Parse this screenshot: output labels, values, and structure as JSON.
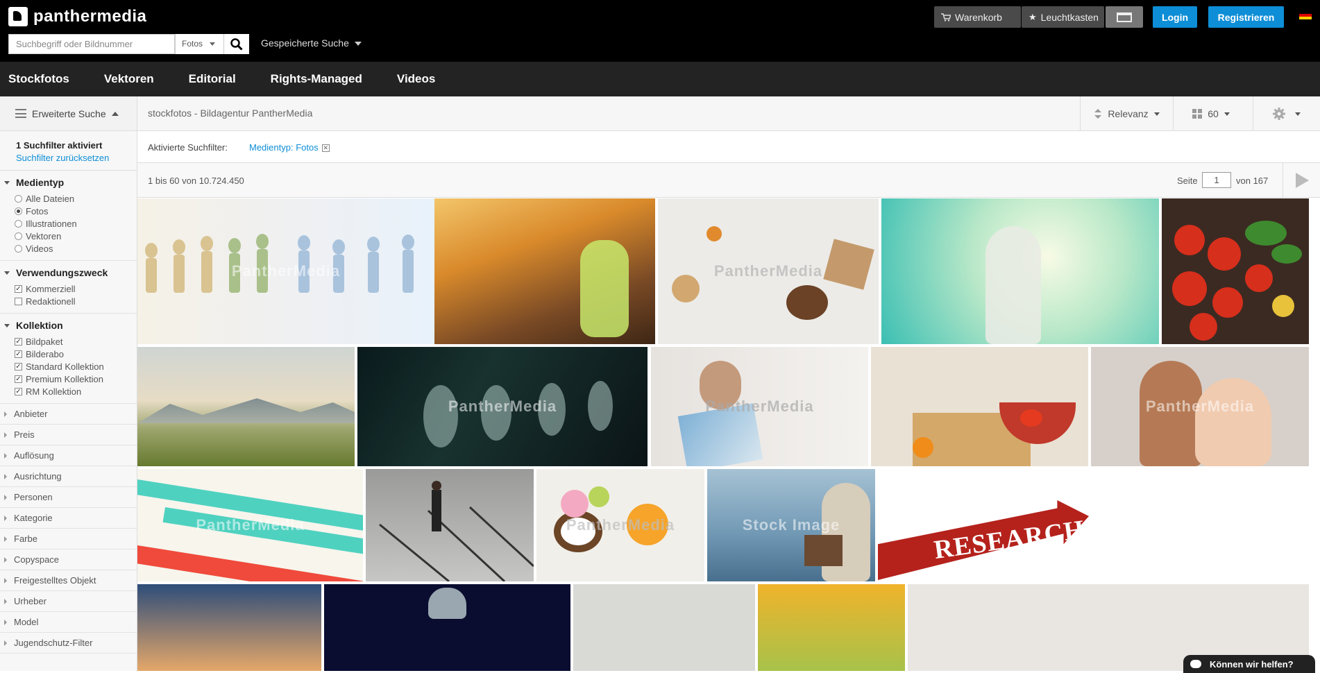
{
  "header": {
    "logo_text": "panthermedia",
    "search_placeholder": "Suchbegriff oder Bildnummer",
    "search_type": "Fotos",
    "saved_search": "Gespeicherte Suche",
    "cart_label": "Warenkorb",
    "lightbox_label": "Leuchtkasten",
    "login_label": "Login",
    "register_label": "Registrieren",
    "language": "de"
  },
  "nav": {
    "items": [
      "Stockfotos",
      "Vektoren",
      "Editorial",
      "Rights-Managed",
      "Videos"
    ]
  },
  "sidebar": {
    "advanced_search": "Erweiterte Suche",
    "filter_active": "1 Suchfilter aktiviert",
    "filter_reset": "Suchfilter zurücksetzen",
    "medientyp": {
      "title": "Medientyp",
      "options": [
        {
          "label": "Alle Dateien",
          "selected": false
        },
        {
          "label": "Fotos",
          "selected": true
        },
        {
          "label": "Illustrationen",
          "selected": false
        },
        {
          "label": "Vektoren",
          "selected": false
        },
        {
          "label": "Videos",
          "selected": false
        }
      ]
    },
    "verwendungszweck": {
      "title": "Verwendungszweck",
      "options": [
        {
          "label": "Kommerziell",
          "checked": true
        },
        {
          "label": "Redaktionell",
          "checked": false
        }
      ]
    },
    "kollektion": {
      "title": "Kollektion",
      "options": [
        {
          "label": "Bildpaket",
          "checked": true
        },
        {
          "label": "Bilderabo",
          "checked": true
        },
        {
          "label": "Standard Kollektion",
          "checked": true
        },
        {
          "label": "Premium Kollektion",
          "checked": true
        },
        {
          "label": "RM Kollektion",
          "checked": true
        }
      ]
    },
    "closed_facets": [
      "Anbieter",
      "Preis",
      "Auflösung",
      "Ausrichtung",
      "Personen",
      "Kategorie",
      "Farbe",
      "Copyspace",
      "Freigestelltes Objekt",
      "Urheber",
      "Model",
      "Jugendschutz-Filter"
    ]
  },
  "main": {
    "breadcrumb": "stockfotos - Bildagentur PantherMedia",
    "sort_label": "Relevanz",
    "per_page": "60",
    "active_filters_label": "Aktivierte Suchfilter:",
    "active_filter_chip": "Medientyp: Fotos",
    "result_count": "1 bis 60 von 10.724.450",
    "page_label": "Seite",
    "page_current": "1",
    "page_total": "von 167"
  },
  "images": {
    "watermark": "PantherMedia",
    "watermark_alt": "Stock Image"
  },
  "help": {
    "label": "Können wir helfen?"
  },
  "colors": {
    "accent": "#0d8ed6",
    "topbar": "#000000",
    "nav": "#232323"
  }
}
